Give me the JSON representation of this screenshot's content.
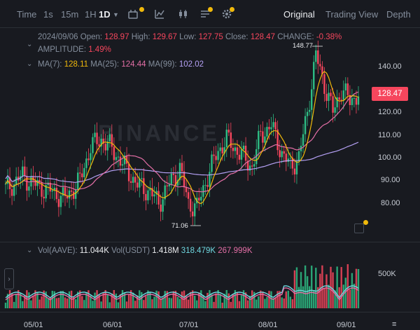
{
  "toolbar": {
    "items": [
      "Time",
      "1s",
      "15m",
      "1H",
      "1D"
    ],
    "active_interval": "1D",
    "views": [
      "Original",
      "Trading View",
      "Depth"
    ],
    "active_view": "Original"
  },
  "info": {
    "date": "2024/09/06",
    "open_label": "Open:",
    "open": "128.97",
    "high_label": "High:",
    "high": "129.67",
    "low_label": "Low:",
    "low": "127.75",
    "close_label": "Close:",
    "close": "128.47",
    "change_label": "CHANGE:",
    "change": "-0.38%",
    "amplitude_label": "AMPLITUDE:",
    "amplitude": "1.49%"
  },
  "ma": {
    "ma7_label": "MA(7):",
    "ma7": "128.11",
    "ma25_label": "MA(25):",
    "ma25": "124.44",
    "ma99_label": "MA(99):",
    "ma99": "102.02"
  },
  "vol": {
    "label1": "Vol(AAVE):",
    "value1": "11.044K",
    "label2": "Vol(USDT)",
    "value2": "1.418M",
    "ma_a": "318.479K",
    "ma_b": "267.999K"
  },
  "price_badge": "128.47",
  "watermark": "BINANCE",
  "extremes": {
    "high": "148.77",
    "low": "71.06"
  },
  "colors": {
    "up": "#2ebd85",
    "down": "#f6465d",
    "ma7": "#f0b90b",
    "ma25": "#e36fa6",
    "ma99": "#b5a1f5"
  },
  "chart_data": {
    "type": "candlestick",
    "y_ticks": [
      "140.00",
      "130.00",
      "120.00",
      "110.00",
      "100.00",
      "90.00",
      "80.00"
    ],
    "x_ticks": [
      "05/01",
      "06/01",
      "07/01",
      "08/01",
      "09/01"
    ],
    "volume_ticks": [
      "500K"
    ],
    "ylim": [
      65,
      152
    ]
  }
}
